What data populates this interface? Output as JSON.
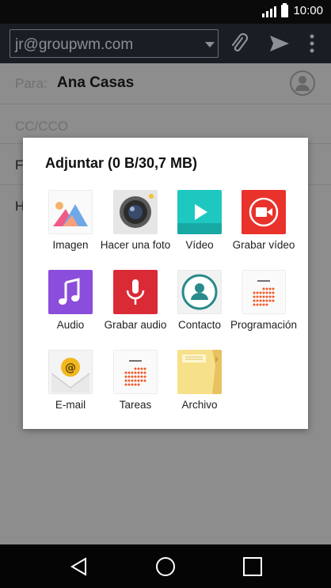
{
  "status_bar": {
    "time": "10:00"
  },
  "toolbar": {
    "account": "jr@groupwm.com"
  },
  "form": {
    "to_label": "Para:",
    "to_value": "Ana Casas",
    "cc_label": "CC/CCO",
    "subject_partial": "F",
    "body_partial": "H"
  },
  "dialog": {
    "title": "Adjuntar (0 B/30,7 MB)",
    "items": [
      {
        "label": "Imagen",
        "icon": "gallery-icon"
      },
      {
        "label": "Hacer una foto",
        "icon": "camera-icon"
      },
      {
        "label": "Vídeo",
        "icon": "video-icon"
      },
      {
        "label": "Grabar vídeo",
        "icon": "record-video-icon"
      },
      {
        "label": "Audio",
        "icon": "music-icon"
      },
      {
        "label": "Grabar audio",
        "icon": "microphone-icon"
      },
      {
        "label": "Contacto",
        "icon": "contact-icon"
      },
      {
        "label": "Programación",
        "icon": "calendar-icon"
      },
      {
        "label": "E-mail",
        "icon": "email-icon"
      },
      {
        "label": "Tareas",
        "icon": "tasks-icon"
      },
      {
        "label": "Archivo",
        "icon": "folder-icon"
      }
    ]
  },
  "colors": {
    "toolbar": "#1a1e24",
    "video": "#1fc7c1",
    "record_video": "#e8322b",
    "audio": "#8b4ddb",
    "record_audio": "#d92a36",
    "contact": "#2a8a8c",
    "dots": "#f05a2a"
  }
}
